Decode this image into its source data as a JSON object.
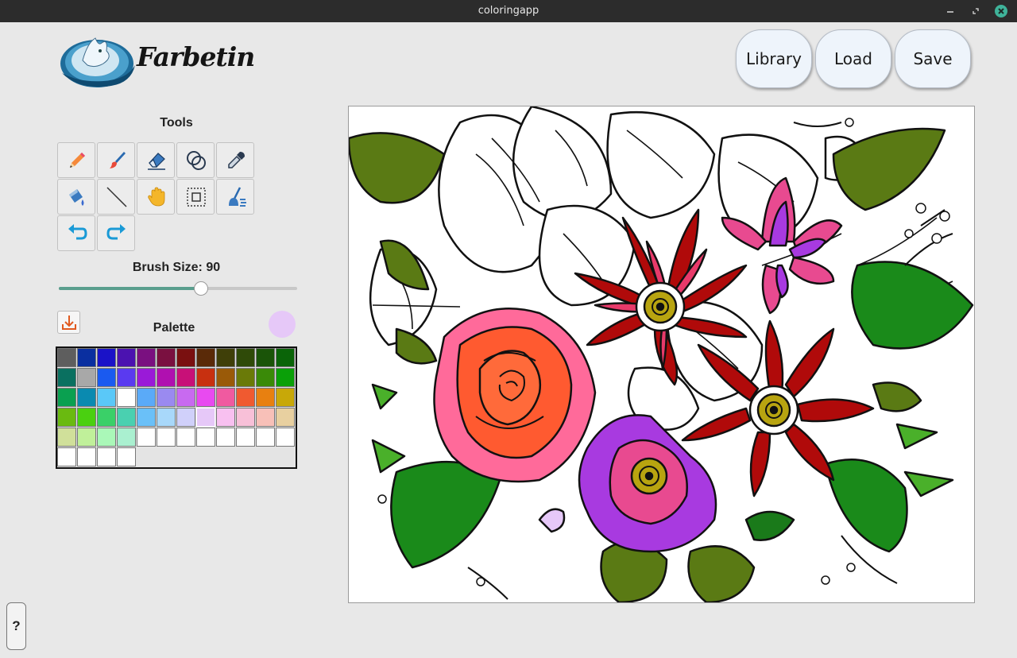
{
  "window": {
    "title": "coloringapp"
  },
  "app": {
    "logo_text": "Farbetin"
  },
  "header_buttons": {
    "library": "Library",
    "load": "Load",
    "save": "Save"
  },
  "tools": {
    "label": "Tools",
    "items": [
      {
        "name": "pencil-icon"
      },
      {
        "name": "brush-icon"
      },
      {
        "name": "eraser-icon"
      },
      {
        "name": "blend-circles-icon"
      },
      {
        "name": "eyedropper-icon"
      },
      {
        "name": "paint-bucket-icon"
      },
      {
        "name": "line-icon"
      },
      {
        "name": "hand-icon"
      },
      {
        "name": "selection-icon"
      },
      {
        "name": "clean-brush-icon"
      },
      {
        "name": "undo-icon"
      },
      {
        "name": "redo-icon"
      }
    ]
  },
  "brush": {
    "label": "Brush Size: 90",
    "value": 90,
    "min": 1,
    "max": 200
  },
  "palette": {
    "label": "Palette",
    "current_color": "#e6c8f8",
    "colors": [
      "#5e5e5e",
      "#0a2fa0",
      "#1a12c8",
      "#4b12b0",
      "#7a1080",
      "#7a1040",
      "#7a1010",
      "#5a2a08",
      "#3f3f08",
      "#2f4a08",
      "#1a5408",
      "#0a6408",
      "#0a7060",
      "#a8a8a8",
      "#1a5af0",
      "#5a3af0",
      "#9a1ad8",
      "#b010b0",
      "#c81078",
      "#c83010",
      "#9a5a08",
      "#6a7a08",
      "#3a8a08",
      "#0aa008",
      "#0aa050",
      "#0a8ab0",
      "#5ac8f8",
      "#ffffff",
      "#5aaaf8",
      "#9a8af0",
      "#c86af0",
      "#e84af0",
      "#f05aa0",
      "#f05a30",
      "#e88010",
      "#c8a808",
      "#6aba10",
      "#4ad010",
      "#3ad068",
      "#4ad0b0",
      "#6ac0f8",
      "#a8d8fa",
      "#d0d0fa",
      "#e6c8f8",
      "#f8c0f0",
      "#f8c0d8",
      "#f8c0b8",
      "#e8d0a0",
      "#d0e09a",
      "#c0f09a",
      "#aaf8b8",
      "#aaf0d0",
      "#ffffff",
      "#ffffff",
      "#ffffff",
      "#ffffff",
      "#ffffff",
      "#ffffff",
      "#ffffff",
      "#ffffff",
      "#ffffff",
      "#ffffff",
      "#ffffff",
      "#ffffff"
    ]
  },
  "help": {
    "label": "?"
  }
}
